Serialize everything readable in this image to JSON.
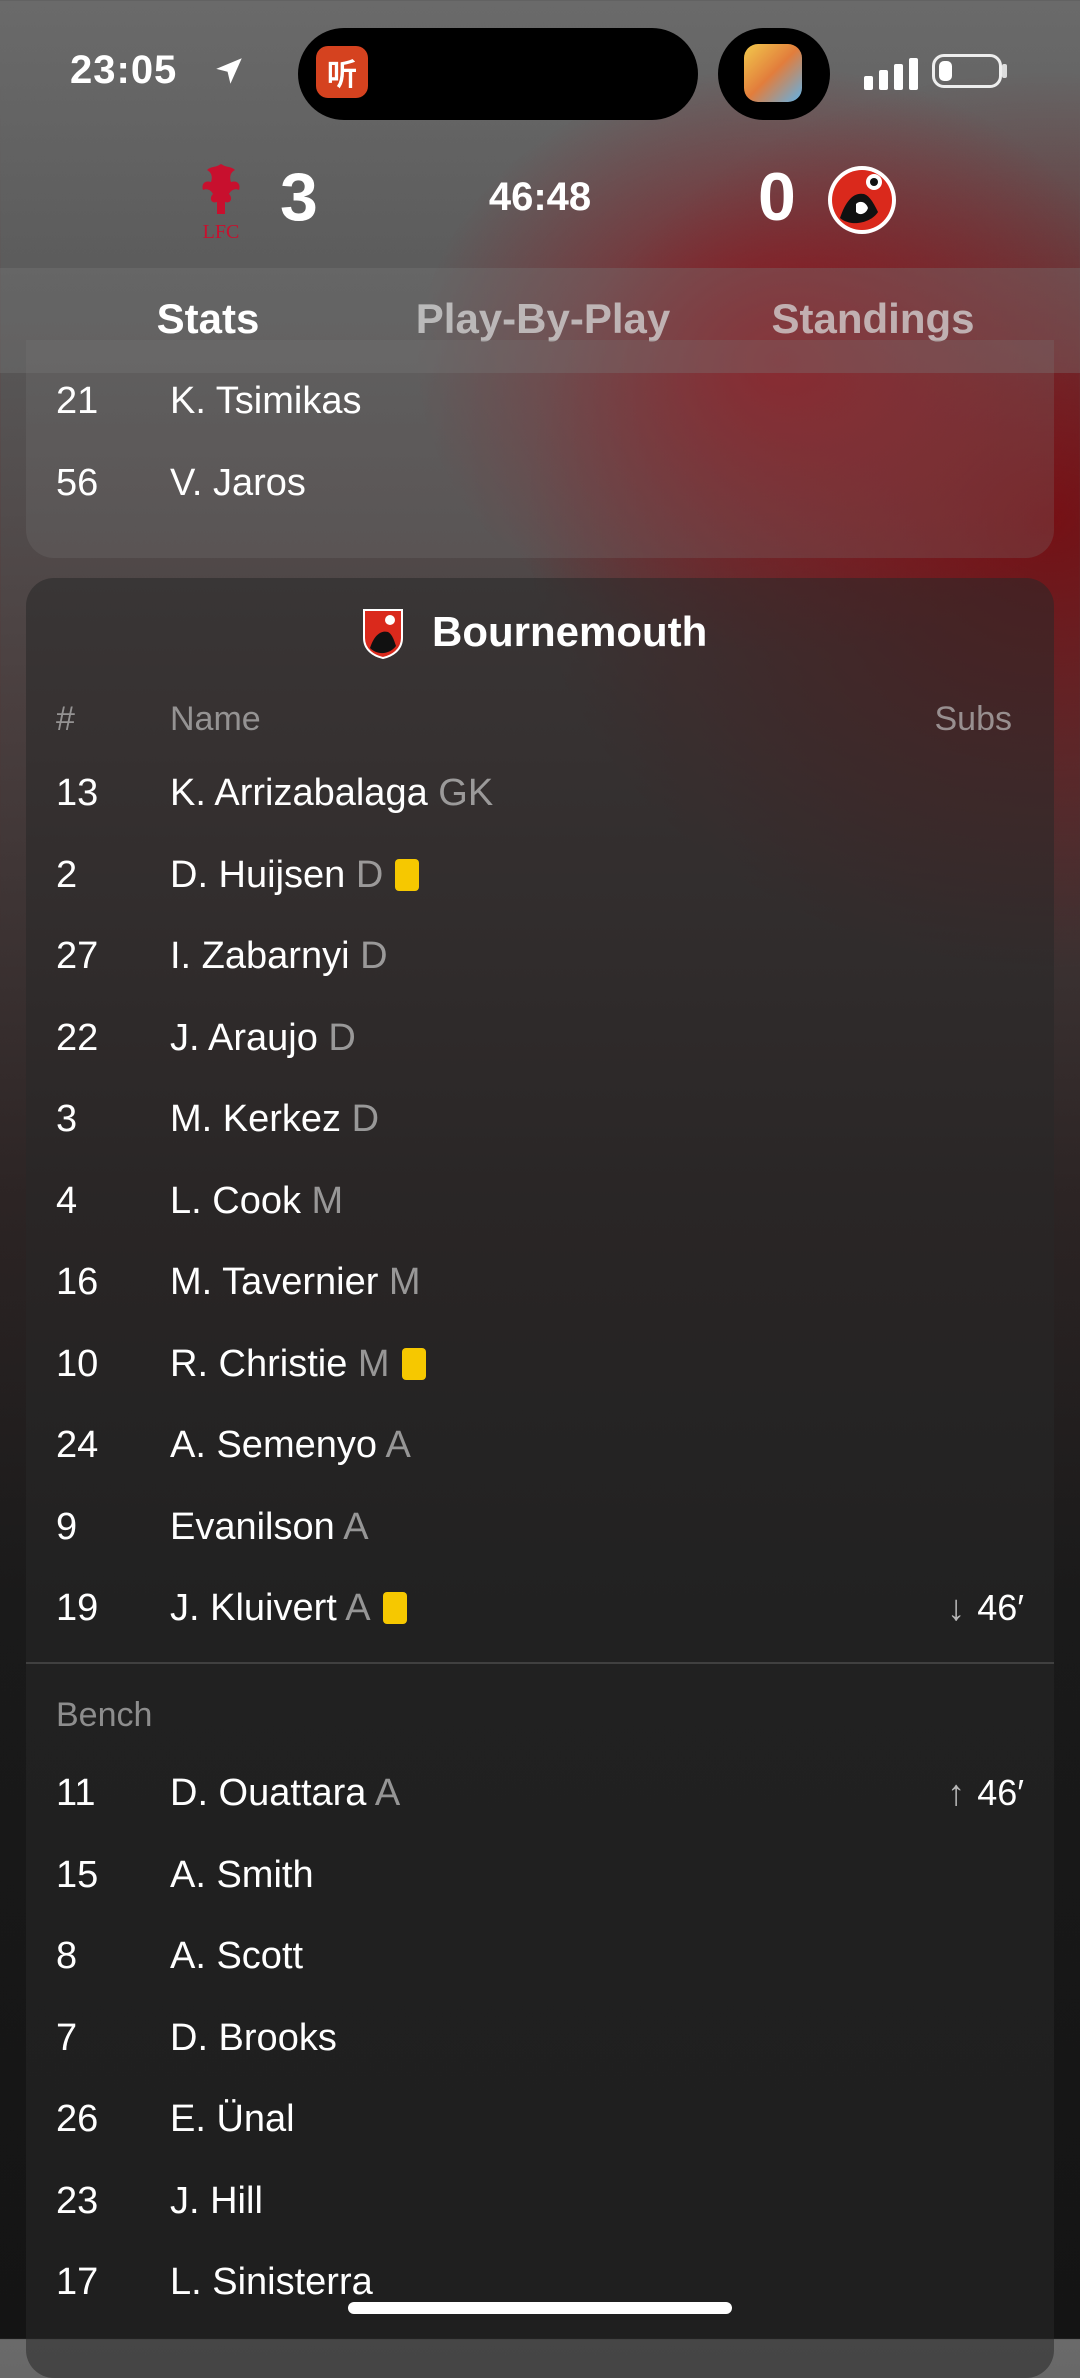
{
  "status_bar": {
    "time": "23:05",
    "island_app_glyph": "听"
  },
  "scoreboard": {
    "home_score": "3",
    "clock": "46:48",
    "away_score": "0",
    "home_crest_text": "LFC"
  },
  "tabs": [
    {
      "label": "Stats",
      "active": true
    },
    {
      "label": "Play-By-Play",
      "active": false
    },
    {
      "label": "Standings",
      "active": false
    }
  ],
  "prev_team_bench_tail": [
    {
      "num": "21",
      "name": "K. Tsimikas"
    },
    {
      "num": "56",
      "name": "V. Jaros"
    }
  ],
  "team": {
    "name": "Bournemouth",
    "header": {
      "num": "#",
      "name": "Name",
      "subs": "Subs"
    },
    "starters": [
      {
        "num": "13",
        "name": "K. Arrizabalaga",
        "pos": "GK",
        "yellow": false,
        "sub": ""
      },
      {
        "num": "2",
        "name": "D. Huijsen",
        "pos": "D",
        "yellow": true,
        "sub": ""
      },
      {
        "num": "27",
        "name": "I. Zabarnyi",
        "pos": "D",
        "yellow": false,
        "sub": ""
      },
      {
        "num": "22",
        "name": "J. Araujo",
        "pos": "D",
        "yellow": false,
        "sub": ""
      },
      {
        "num": "3",
        "name": "M. Kerkez",
        "pos": "D",
        "yellow": false,
        "sub": ""
      },
      {
        "num": "4",
        "name": "L. Cook",
        "pos": "M",
        "yellow": false,
        "sub": ""
      },
      {
        "num": "16",
        "name": "M. Tavernier",
        "pos": "M",
        "yellow": false,
        "sub": ""
      },
      {
        "num": "10",
        "name": "R. Christie",
        "pos": "M",
        "yellow": true,
        "sub": ""
      },
      {
        "num": "24",
        "name": "A. Semenyo",
        "pos": "A",
        "yellow": false,
        "sub": ""
      },
      {
        "num": "9",
        "name": "Evanilson",
        "pos": "A",
        "yellow": false,
        "sub": ""
      },
      {
        "num": "19",
        "name": "J. Kluivert",
        "pos": "A",
        "yellow": true,
        "sub": "46′",
        "sub_dir": "↓"
      }
    ],
    "bench_label": "Bench",
    "bench": [
      {
        "num": "11",
        "name": "D. Ouattara",
        "pos": "A",
        "sub": "46′",
        "sub_dir": "↑"
      },
      {
        "num": "15",
        "name": "A. Smith",
        "pos": "",
        "sub": ""
      },
      {
        "num": "8",
        "name": "A. Scott",
        "pos": "",
        "sub": ""
      },
      {
        "num": "7",
        "name": "D. Brooks",
        "pos": "",
        "sub": ""
      },
      {
        "num": "26",
        "name": "E. Ünal",
        "pos": "",
        "sub": ""
      },
      {
        "num": "23",
        "name": "J. Hill",
        "pos": "",
        "sub": ""
      },
      {
        "num": "17",
        "name": "L. Sinisterra",
        "pos": "",
        "sub": ""
      }
    ]
  },
  "colors": {
    "yellow_card": "#f6c800",
    "liverpool_red": "#c8102e",
    "bournemouth_red": "#da291c"
  }
}
